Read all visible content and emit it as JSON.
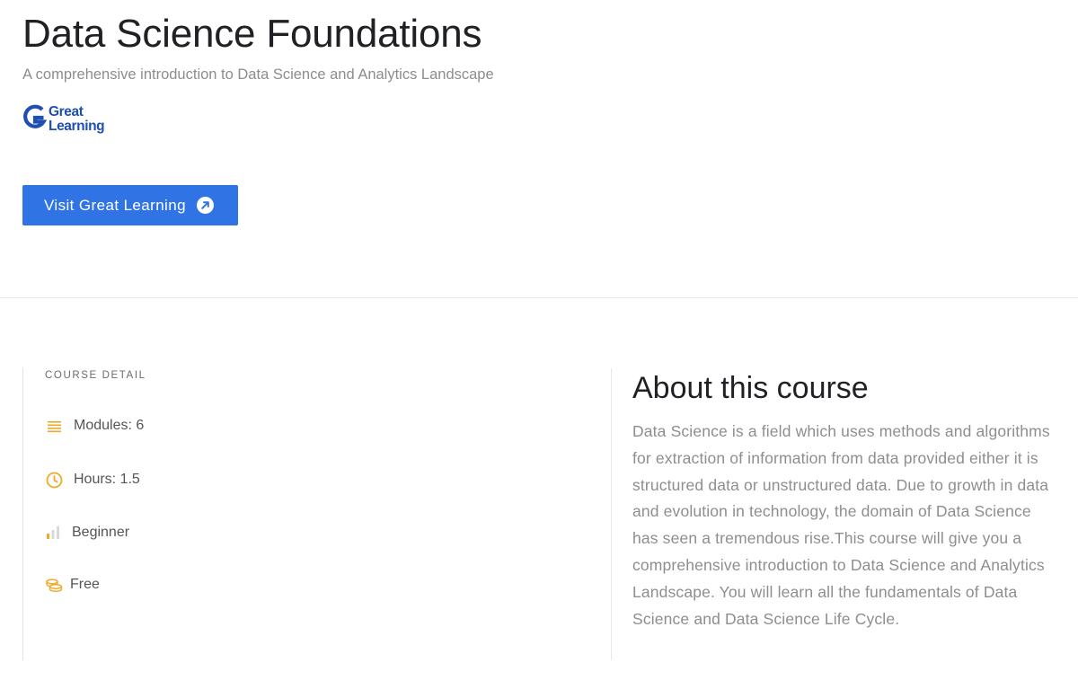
{
  "course": {
    "title": "Data Science Foundations",
    "subtitle": "A comprehensive introduction to Data Science and Analytics Landscape"
  },
  "provider": {
    "logo_text_line1": "Great",
    "logo_text_line2": "Learning",
    "logo_color": "#1f4fb5"
  },
  "cta": {
    "label": "Visit Great Learning",
    "icon": "external-link-arrow-icon",
    "color": "#2f73e4"
  },
  "details": {
    "heading": "COURSE DETAIL",
    "items": [
      {
        "icon": "list-lines-icon",
        "label": "Modules: 6"
      },
      {
        "icon": "clock-icon",
        "label": "Hours: 1.5"
      },
      {
        "icon": "level-bars-icon",
        "label": "Beginner"
      },
      {
        "icon": "coins-icon",
        "label": "Free"
      }
    ],
    "icon_color": "#f0a928"
  },
  "about": {
    "title": "About this course",
    "body": "Data Science is a field which uses methods and algorithms for extraction of information from data provided either it is structured data or unstructured data. Due to growth in data and evolution in technology, the domain of Data Science has seen a tremendous rise.This course will give you a comprehensive introduction to Data Science and Analytics Landscape. You will learn all the fundamentals of Data Science and Data Science Life Cycle."
  }
}
